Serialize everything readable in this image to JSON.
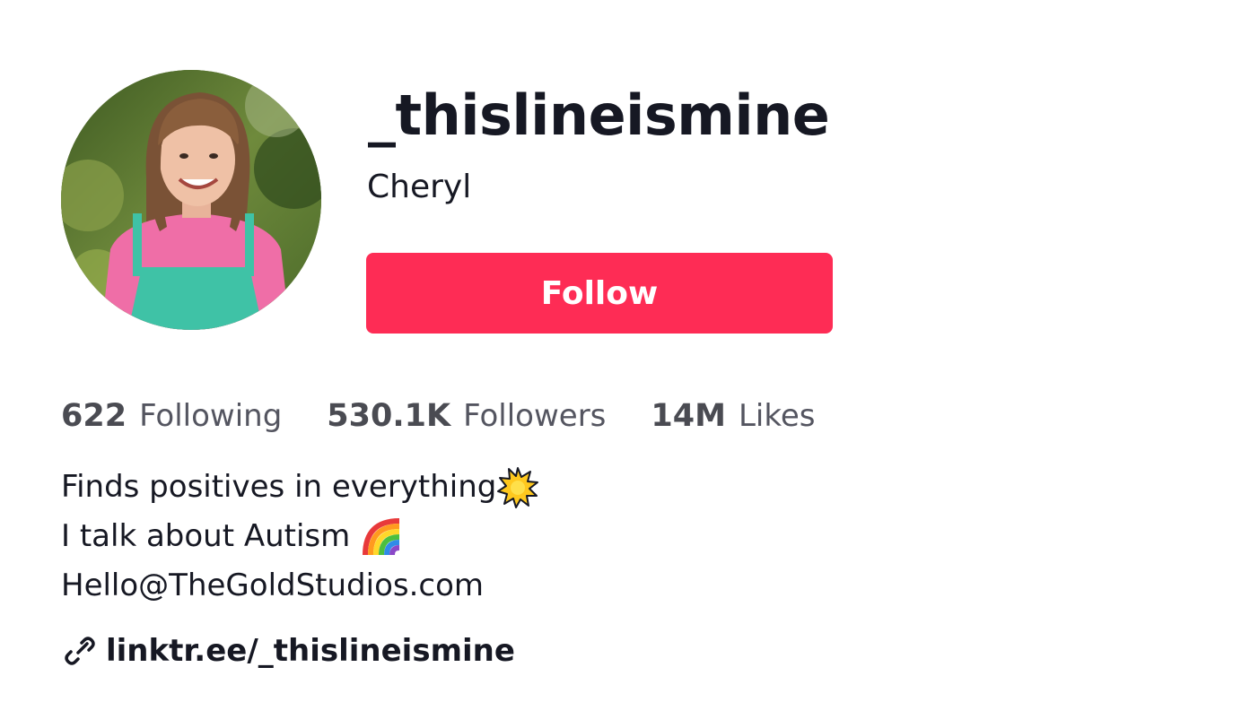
{
  "profile": {
    "username": "_thislineismine",
    "nickname": "Cheryl",
    "follow_label": "Follow",
    "avatar_icon": "avatar-photo",
    "accent_color": "#fe2c55"
  },
  "stats": [
    {
      "value": "622",
      "label": "Following"
    },
    {
      "value": "530.1K",
      "label": "Followers"
    },
    {
      "value": "14M",
      "label": "Likes"
    }
  ],
  "bio": {
    "line1": "Finds positives in everything",
    "line1_emoji": "sunburst-emoji",
    "line2": "I talk about Autism ",
    "line2_emoji": "rainbow-emoji",
    "line3": "Hello@TheGoldStudios.com"
  },
  "link": {
    "icon": "link-icon",
    "text": "linktr.ee/_thislineismine"
  }
}
